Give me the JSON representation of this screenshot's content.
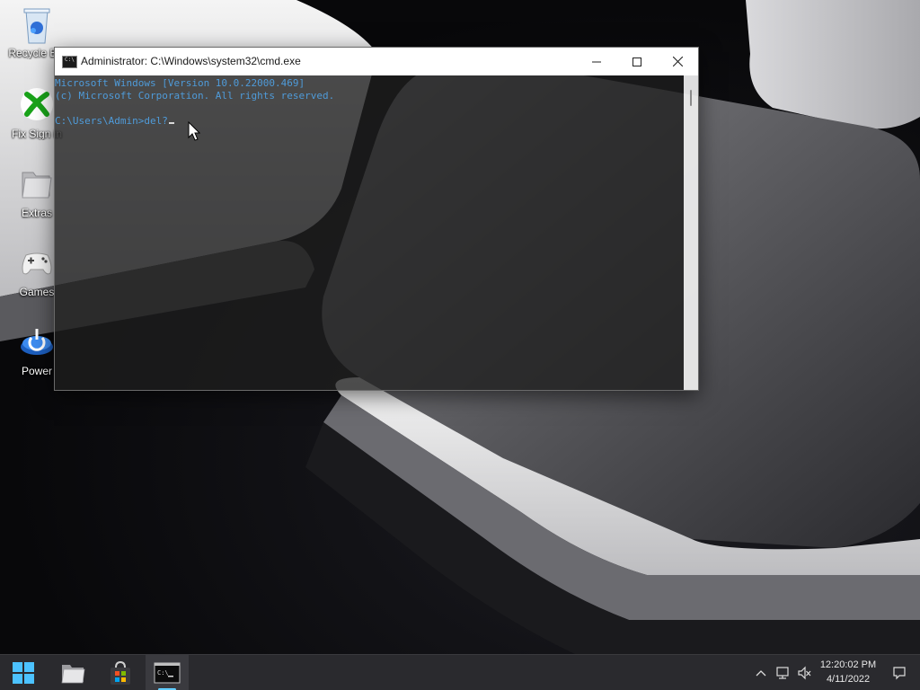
{
  "desktop": {
    "icons": [
      {
        "label": "Recycle Bin",
        "icon": "recycle-bin-icon"
      },
      {
        "label": "Fix Sign in",
        "icon": "xbox-icon"
      },
      {
        "label": "Extras",
        "icon": "folder-icon"
      },
      {
        "label": "Games",
        "icon": "gamepad-icon"
      },
      {
        "label": "Power",
        "icon": "power-icon"
      }
    ]
  },
  "window": {
    "title": "Administrator: C:\\Windows\\system32\\cmd.exe",
    "icon": "cmd-icon",
    "controls": {
      "minimize": "minimize-icon",
      "maximize": "maximize-icon",
      "close": "close-icon"
    }
  },
  "console": {
    "lines": [
      "Microsoft Windows [Version 10.0.22000.469]",
      "(c) Microsoft Corporation. All rights reserved.",
      "",
      "C:\\Users\\Admin>del?"
    ],
    "text_color": "#4f9bd9"
  },
  "taskbar": {
    "items": [
      {
        "name": "start",
        "icon": "windows-start-icon"
      },
      {
        "name": "file-explorer",
        "icon": "file-explorer-icon"
      },
      {
        "name": "store",
        "icon": "store-icon"
      },
      {
        "name": "command-prompt",
        "icon": "cmd-icon",
        "active": true
      }
    ],
    "tray": {
      "icons": [
        "chevron-up-icon",
        "network-icon",
        "volume-muted-icon",
        "notification-icon"
      ]
    },
    "clock": {
      "time": "12:20:02 PM",
      "date": "4/11/2022"
    },
    "accent": "#60cdff"
  }
}
